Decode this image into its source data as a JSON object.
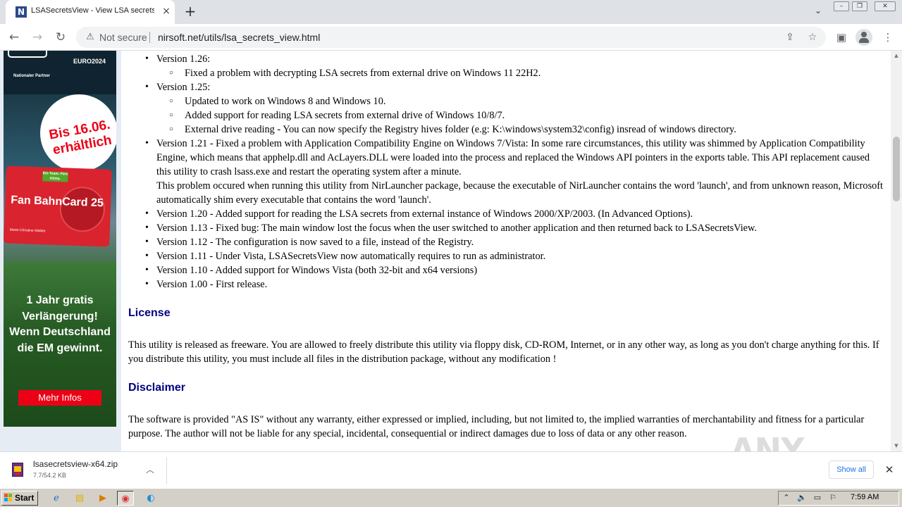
{
  "browser": {
    "tab_title": "LSASecretsView - View LSA secrets s",
    "tab_favicon": "N",
    "new_tab_label": "+",
    "security_label": "Not secure",
    "url": "nirsoft.net/utils/lsa_secrets_view.html"
  },
  "ad": {
    "euro": "EURO2024",
    "partner": "Nationaler Partner",
    "date_badge": "Bis 16.06. erhältlich",
    "card_tag": "Ein Team. Fürs Klima.",
    "card_title": "Fan BahnCard 25",
    "card_name": "Marie-Christine Walder",
    "slogan": "1 Jahr gratis Verlängerung! Wenn Deutschland die EM gewinnt.",
    "button": "Mehr Infos"
  },
  "versions": [
    {
      "text": "Version 1.26:",
      "subs": [
        "Fixed a problem with decrypting LSA secrets from external drive on Windows 11 22H2."
      ]
    },
    {
      "text": "Version 1.25:",
      "subs": [
        "Updated to work on Windows 8 and Windows 10.",
        "Added support for reading LSA secrets from external drive of Windows 10/8/7.",
        "External drive reading - You can now specify the Registry hives folder (e.g: K:\\windows\\system32\\config) insread of windows directory."
      ]
    },
    {
      "text": "Version 1.21 - Fixed a problem with Application Compatibility Engine on Windows 7/Vista: In some rare circumstances, this utility was shimmed by Application Compatibility Engine, which means that apphelp.dll and AcLayers.DLL were loaded into the process and replaced the Windows API pointers in the exports table. This API replacement caused this utility to crash lsass.exe and restart the operating system after a minute.",
      "extra": "This problem occured when running this utility from NirLauncher package, because the executable of NirLauncher contains the word 'launch', and from unknown reason, Microsoft automatically shim every executable that contains the word 'launch'.",
      "subs": []
    },
    {
      "text": "Version 1.20 - Added support for reading the LSA secrets from external instance of Windows 2000/XP/2003. (In Advanced Options).",
      "subs": []
    },
    {
      "text": "Version 1.13 - Fixed bug: The main window lost the focus when the user switched to another application and then returned back to LSASecretsView.",
      "subs": []
    },
    {
      "text": "Version 1.12 - The configuration is now saved to a file, instead of the Registry.",
      "subs": []
    },
    {
      "text": "Version 1.11 - Under Vista, LSASecretsView now automatically requires to run as administrator.",
      "subs": []
    },
    {
      "text": "Version 1.10 - Added support for Windows Vista (both 32-bit and x64 versions)",
      "subs": []
    },
    {
      "text": "Version 1.00 - First release.",
      "subs": []
    }
  ],
  "license": {
    "heading": "License",
    "text": "This utility is released as freeware. You are allowed to freely distribute this utility via floppy disk, CD-ROM, Internet, or in any other way, as long as you don't charge anything for this. If you distribute this utility, you must include all files in the distribution package, without any modification !"
  },
  "disclaimer": {
    "heading": "Disclaimer",
    "text": "The software is provided \"AS IS\" without any warranty, either expressed or implied, including, but not limited to, the implied warranties of merchantability and fitness for a particular purpose. The author will not be liable for any special, incidental, consequential or indirect damages due to loss of data or any other reason."
  },
  "watermark": "ANY RUN",
  "download": {
    "filename": "lsasecretsview-x64.zip",
    "progress": "7.7/54.2 KB",
    "show_all": "Show all"
  },
  "taskbar": {
    "start": "Start",
    "clock": "7:59 AM"
  },
  "icons": {
    "back": "back-arrow-icon",
    "forward": "forward-arrow-icon",
    "reload": "reload-icon",
    "warning": "warning-icon",
    "share": "share-icon",
    "bookmark": "star-icon",
    "sidepanel": "side-panel-icon",
    "menu": "kebab-menu-icon"
  }
}
